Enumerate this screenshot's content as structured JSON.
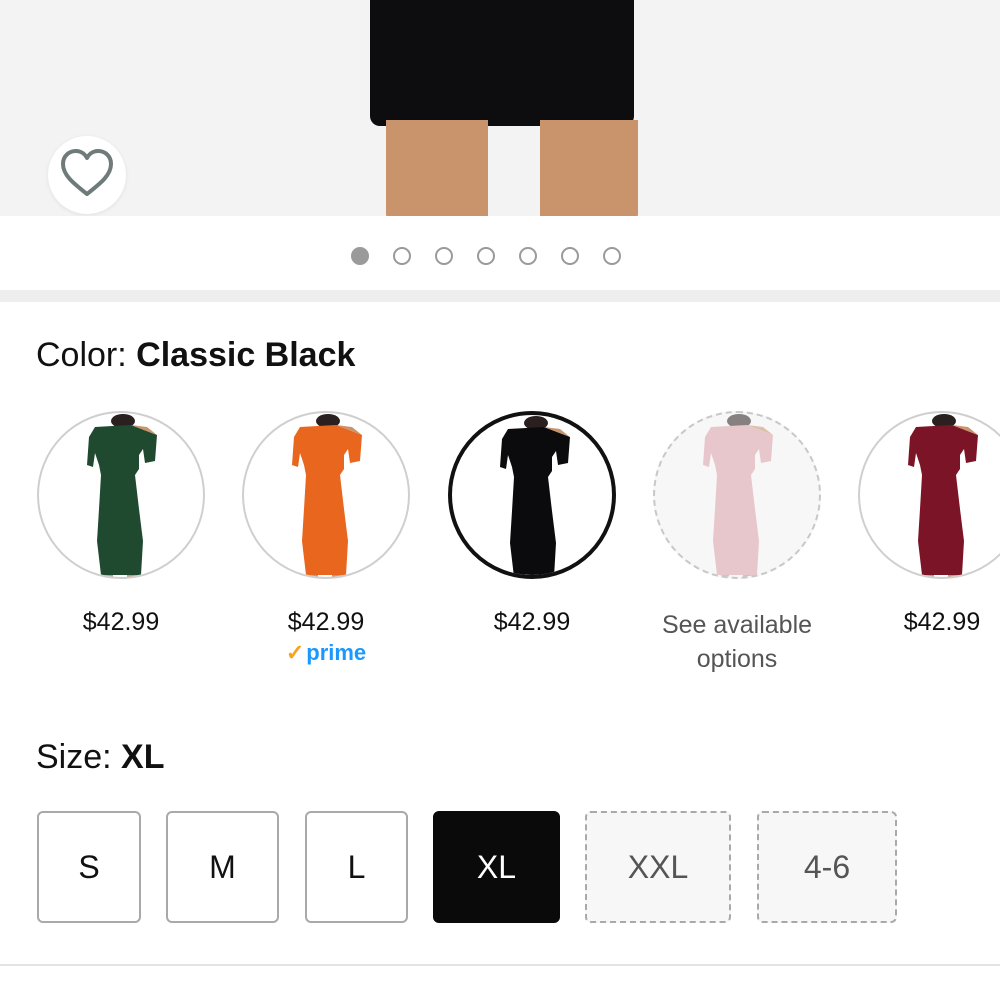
{
  "hero": {
    "favorite_icon": "heart-outline-icon",
    "carousel": {
      "total": 7,
      "active_index": 0
    }
  },
  "color": {
    "label": "Color:",
    "selected_name": "Classic Black",
    "options": [
      {
        "color": "#1f4a30",
        "price": "$42.99",
        "prime": false,
        "available": true,
        "selected": false
      },
      {
        "color": "#e8661d",
        "price": "$42.99",
        "prime": true,
        "prime_text": "prime",
        "available": true,
        "selected": false
      },
      {
        "color": "#0b0a0c",
        "price": "$42.99",
        "prime": false,
        "available": true,
        "selected": true
      },
      {
        "color": "#dba1aa",
        "price": "",
        "see_text": "See available options",
        "prime": false,
        "available": false,
        "selected": false
      },
      {
        "color": "#7c1428",
        "price": "$42.99",
        "prime": false,
        "available": true,
        "selected": false
      }
    ]
  },
  "size": {
    "label": "Size:",
    "selected_value": "XL",
    "options": [
      {
        "label": "S",
        "state": "available"
      },
      {
        "label": "M",
        "state": "available"
      },
      {
        "label": "L",
        "state": "available"
      },
      {
        "label": "XL",
        "state": "selected"
      },
      {
        "label": "XXL",
        "state": "unavailable"
      },
      {
        "label": "4-6",
        "state": "unavailable"
      }
    ]
  },
  "colors": {
    "skin": "#c9946c",
    "selected_dark": "#0a0a0a",
    "prime_blue": "#1a98ff",
    "prime_check": "#f7a21b"
  }
}
